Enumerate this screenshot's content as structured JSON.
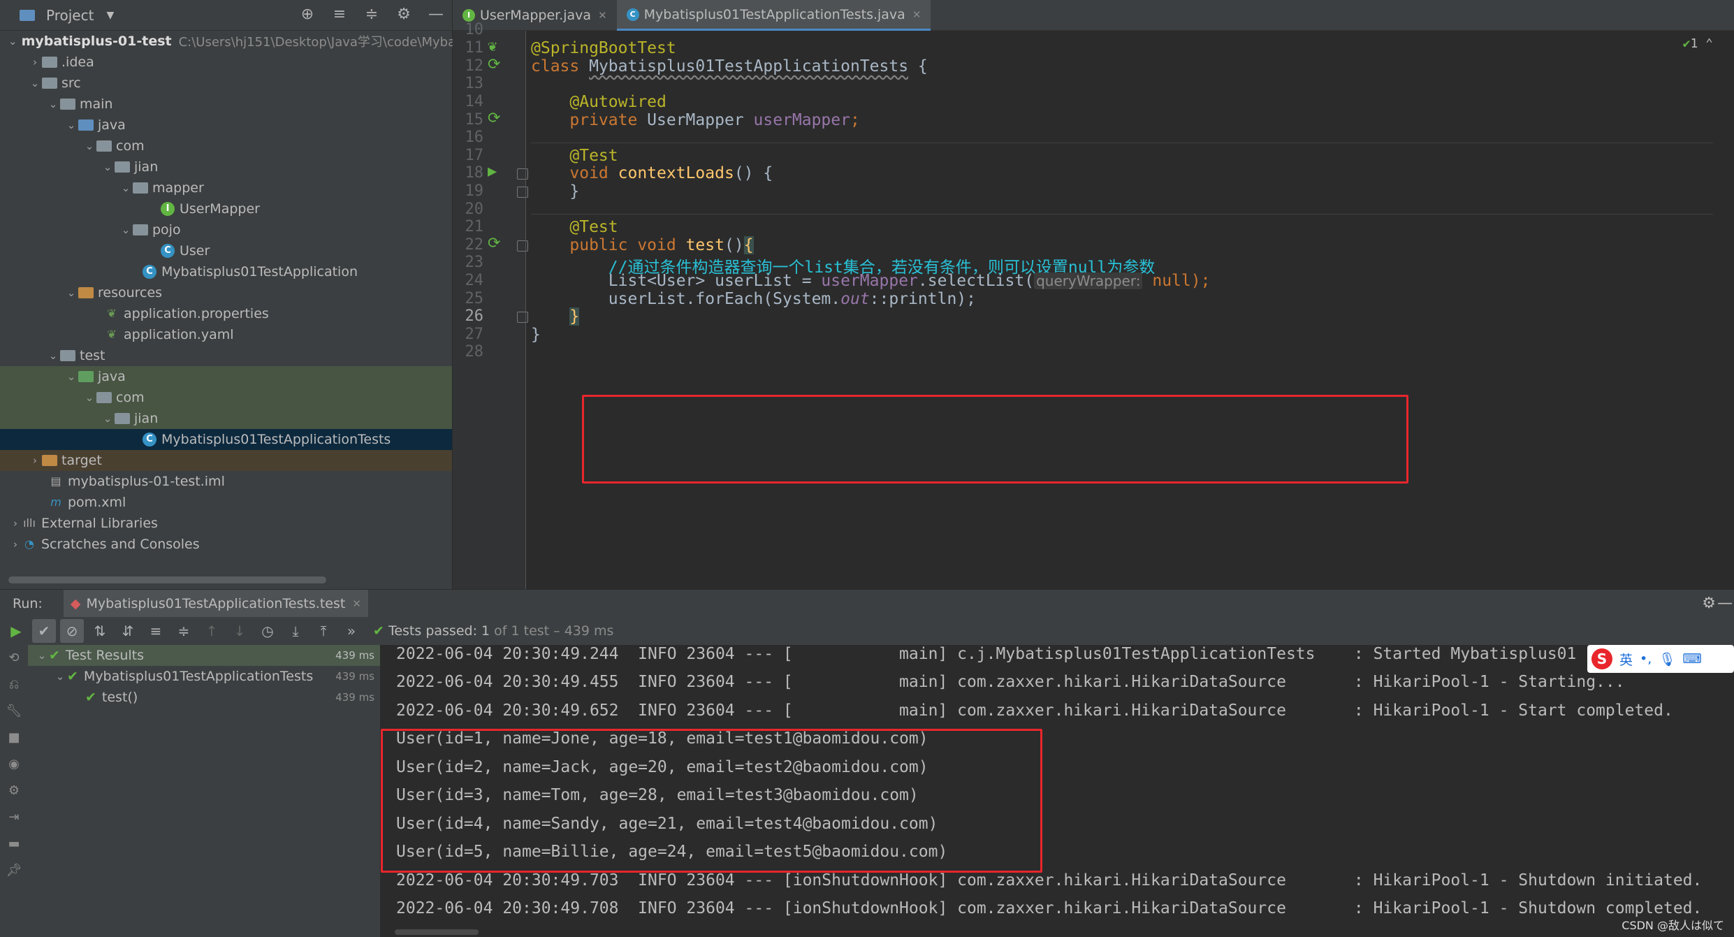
{
  "project": {
    "title": "Project",
    "root_name": "mybatisplus-01-test",
    "root_path": "C:\\Users\\hj151\\Desktop\\Java学习\\code\\Myba",
    "items": [
      {
        "label": ".idea"
      },
      {
        "label": "src"
      },
      {
        "label": "main"
      },
      {
        "label": "java"
      },
      {
        "label": "com"
      },
      {
        "label": "jian"
      },
      {
        "label": "mapper"
      },
      {
        "label": "UserMapper"
      },
      {
        "label": "pojo"
      },
      {
        "label": "User"
      },
      {
        "label": "Mybatisplus01TestApplication"
      },
      {
        "label": "resources"
      },
      {
        "label": "application.properties"
      },
      {
        "label": "application.yaml"
      },
      {
        "label": "test"
      },
      {
        "label": "java"
      },
      {
        "label": "com"
      },
      {
        "label": "jian"
      },
      {
        "label": "Mybatisplus01TestApplicationTests"
      },
      {
        "label": "target"
      },
      {
        "label": "mybatisplus-01-test.iml"
      },
      {
        "label": "pom.xml"
      },
      {
        "label": "External Libraries"
      },
      {
        "label": "Scratches and Consoles"
      }
    ]
  },
  "tabs": [
    {
      "label": "UserMapper.java"
    },
    {
      "label": "Mybatisplus01TestApplicationTests.java"
    }
  ],
  "editor": {
    "inspection_count": "1",
    "line_numbers": [
      "10",
      "11",
      "12",
      "13",
      "14",
      "15",
      "16",
      "17",
      "18",
      "19",
      "20",
      "21",
      "22",
      "23",
      "24",
      "25",
      "26",
      "27",
      "28"
    ],
    "lines": {
      "l11_ann": "@SpringBootTest",
      "l12_kw": "class ",
      "l12_name": "Mybatisplus01TestApplicationTests",
      "l12_brace": " {",
      "l14_ann": "@Autowired",
      "l15_kw": "private ",
      "l15_type": "UserMapper ",
      "l15_field": "userMapper",
      "l15_end": ";",
      "l17_ann": "@Test",
      "l18_kw": "void ",
      "l18_fn": "contextLoads",
      "l18_end": "() {",
      "l19": "}",
      "l21_ann": "@Test",
      "l22_kw": "public void ",
      "l22_fn": "test",
      "l22_paren": "()",
      "l22_brace": "{",
      "l23_comment": "//通过条件构造器查询一个list集合，若没有条件，则可以设置null为参数",
      "l24_a": "List<User> userList = ",
      "l24_field": "userMapper",
      "l24_b": ".selectList(",
      "l24_hint": "queryWrapper:",
      "l24_null": "null",
      "l24_end": ");",
      "l25_a": "userList.forEach(System.",
      "l25_out": "out",
      "l25_b": "::println);",
      "l26": "}",
      "l27": "}"
    }
  },
  "run": {
    "label": "Run:",
    "config": "Mybatisplus01TestApplicationTests.test",
    "status_prefix": "Tests passed: ",
    "status_count": "1",
    "status_suffix": " of 1 test – 439 ms",
    "results": [
      {
        "label": "Test Results",
        "time": "439 ms"
      },
      {
        "label": "Mybatisplus01TestApplicationTests",
        "time": "439 ms"
      },
      {
        "label": "test()",
        "time": "439 ms"
      }
    ],
    "console": [
      "2022-06-04 20:30:49.244  INFO 23604 --- [           main] c.j.Mybatisplus01TestApplicationTests    : Started Mybatisplus01",
      "2022-06-04 20:30:49.455  INFO 23604 --- [           main] com.zaxxer.hikari.HikariDataSource       : HikariPool-1 - Starting...",
      "2022-06-04 20:30:49.652  INFO 23604 --- [           main] com.zaxxer.hikari.HikariDataSource       : HikariPool-1 - Start completed.",
      "User(id=1, name=Jone, age=18, email=test1@baomidou.com)",
      "User(id=2, name=Jack, age=20, email=test2@baomidou.com)",
      "User(id=3, name=Tom, age=28, email=test3@baomidou.com)",
      "User(id=4, name=Sandy, age=21, email=test4@baomidou.com)",
      "User(id=5, name=Billie, age=24, email=test5@baomidou.com)",
      "2022-06-04 20:30:49.703  INFO 23604 --- [ionShutdownHook] com.zaxxer.hikari.HikariDataSource       : HikariPool-1 - Shutdown initiated.",
      "2022-06-04 20:30:49.708  INFO 23604 --- [ionShutdownHook] com.zaxxer.hikari.HikariDataSource       : HikariPool-1 - Shutdown completed."
    ]
  },
  "ime": {
    "lang": "英",
    "punct": "•,"
  },
  "watermark": "CSDN @敌人は似て",
  "colors": {
    "accent": "#4a88c7",
    "highlight_box": "#e8262c",
    "pass": "#62b543"
  }
}
